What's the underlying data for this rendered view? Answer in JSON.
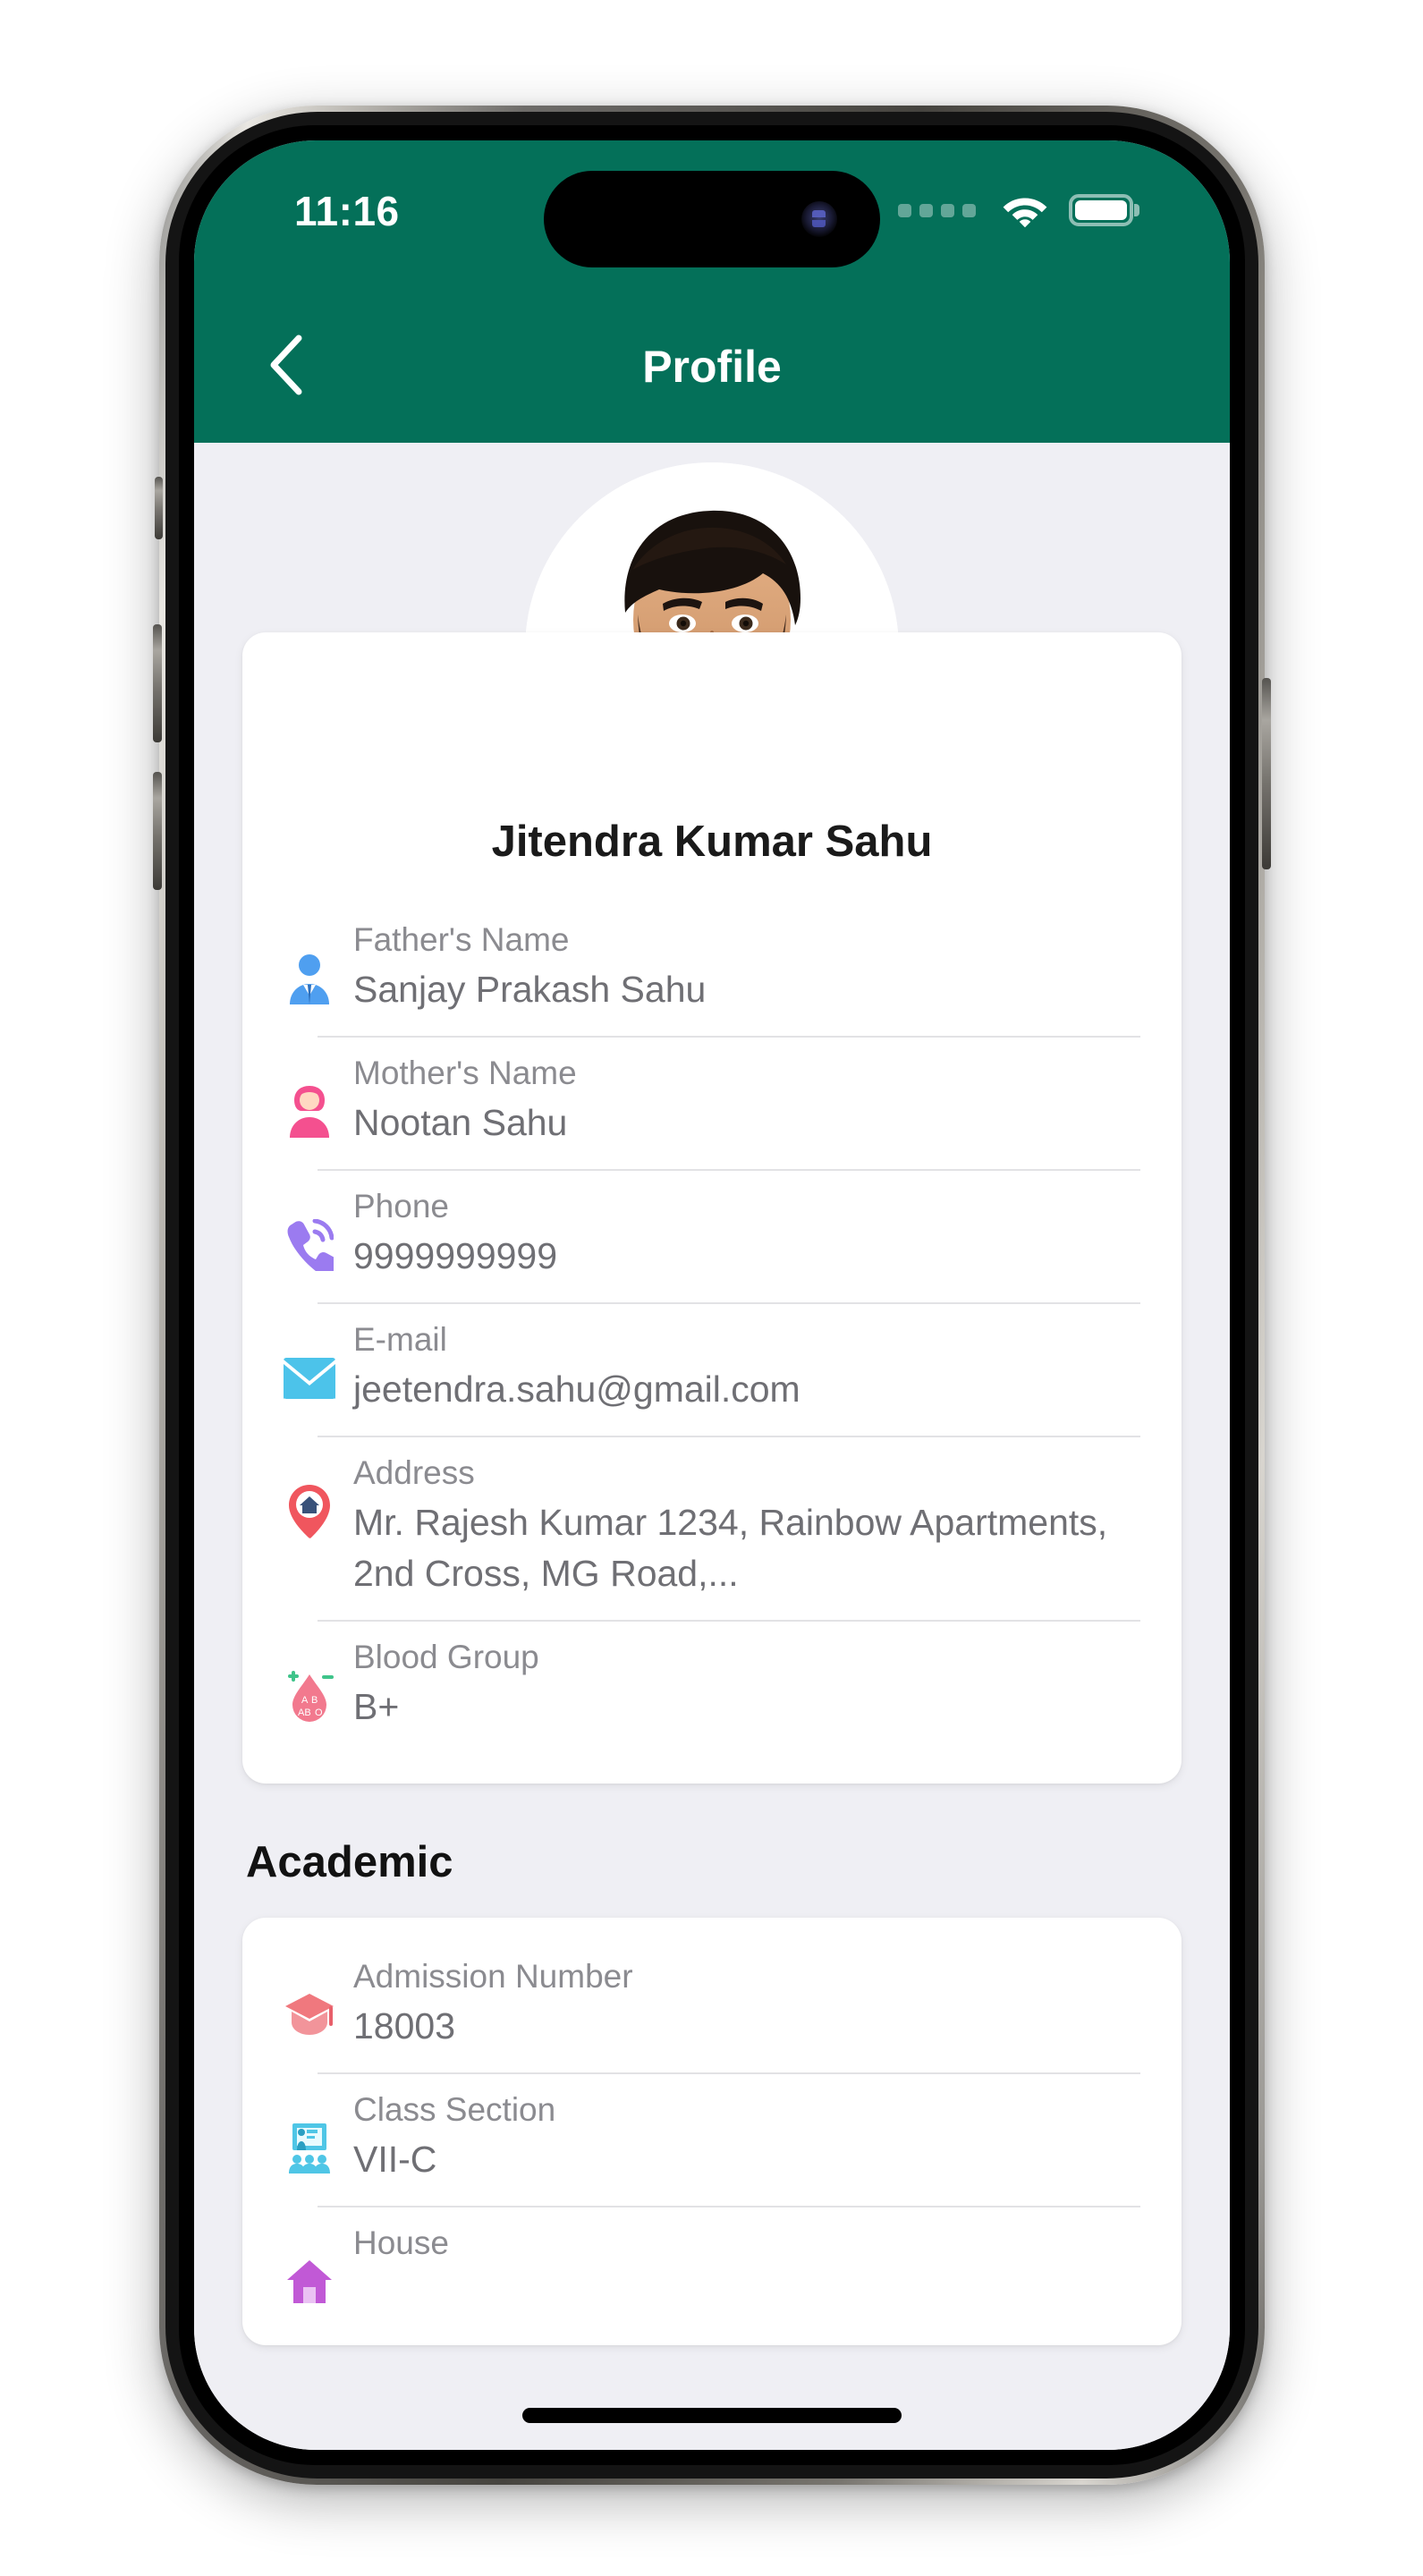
{
  "status_bar": {
    "time": "11:16",
    "signal_icon": "signal-dots-icon",
    "wifi_icon": "wifi-icon",
    "battery_icon": "battery-full-icon"
  },
  "navbar": {
    "back_icon": "chevron-left-icon",
    "title": "Profile"
  },
  "profile": {
    "avatar_alt": "profile-photo",
    "camera_button_icon": "camera-icon",
    "name": "Jitendra Kumar Sahu",
    "fields": [
      {
        "icon": "male-user-icon",
        "label": "Father's Name",
        "value": "Sanjay Prakash Sahu"
      },
      {
        "icon": "female-user-icon",
        "label": "Mother's Name",
        "value": "Nootan Sahu"
      },
      {
        "icon": "phone-icon",
        "label": "Phone",
        "value": "9999999999"
      },
      {
        "icon": "envelope-icon",
        "label": "E-mail",
        "value": "jeetendra.sahu@gmail.com"
      },
      {
        "icon": "map-pin-home-icon",
        "label": "Address",
        "value": "Mr. Rajesh Kumar 1234, Rainbow Apartments, 2nd Cross, MG Road,..."
      },
      {
        "icon": "blood-drop-icon",
        "label": "Blood Group",
        "value": "B+"
      }
    ]
  },
  "academic": {
    "section_title": "Academic",
    "fields": [
      {
        "icon": "graduation-cap-icon",
        "label": "Admission Number",
        "value": "18003"
      },
      {
        "icon": "classroom-icon",
        "label": "Class Section",
        "value": "VII-C"
      },
      {
        "icon": "house-icon",
        "label": "House",
        "value": ""
      }
    ]
  },
  "colors": {
    "brand_green": "#047059",
    "camera_badge_green": "#0a7055",
    "page_background": "#efeff4",
    "card_background": "#ffffff",
    "label_grey": "#8b8b90",
    "value_grey": "#6f6f74"
  }
}
